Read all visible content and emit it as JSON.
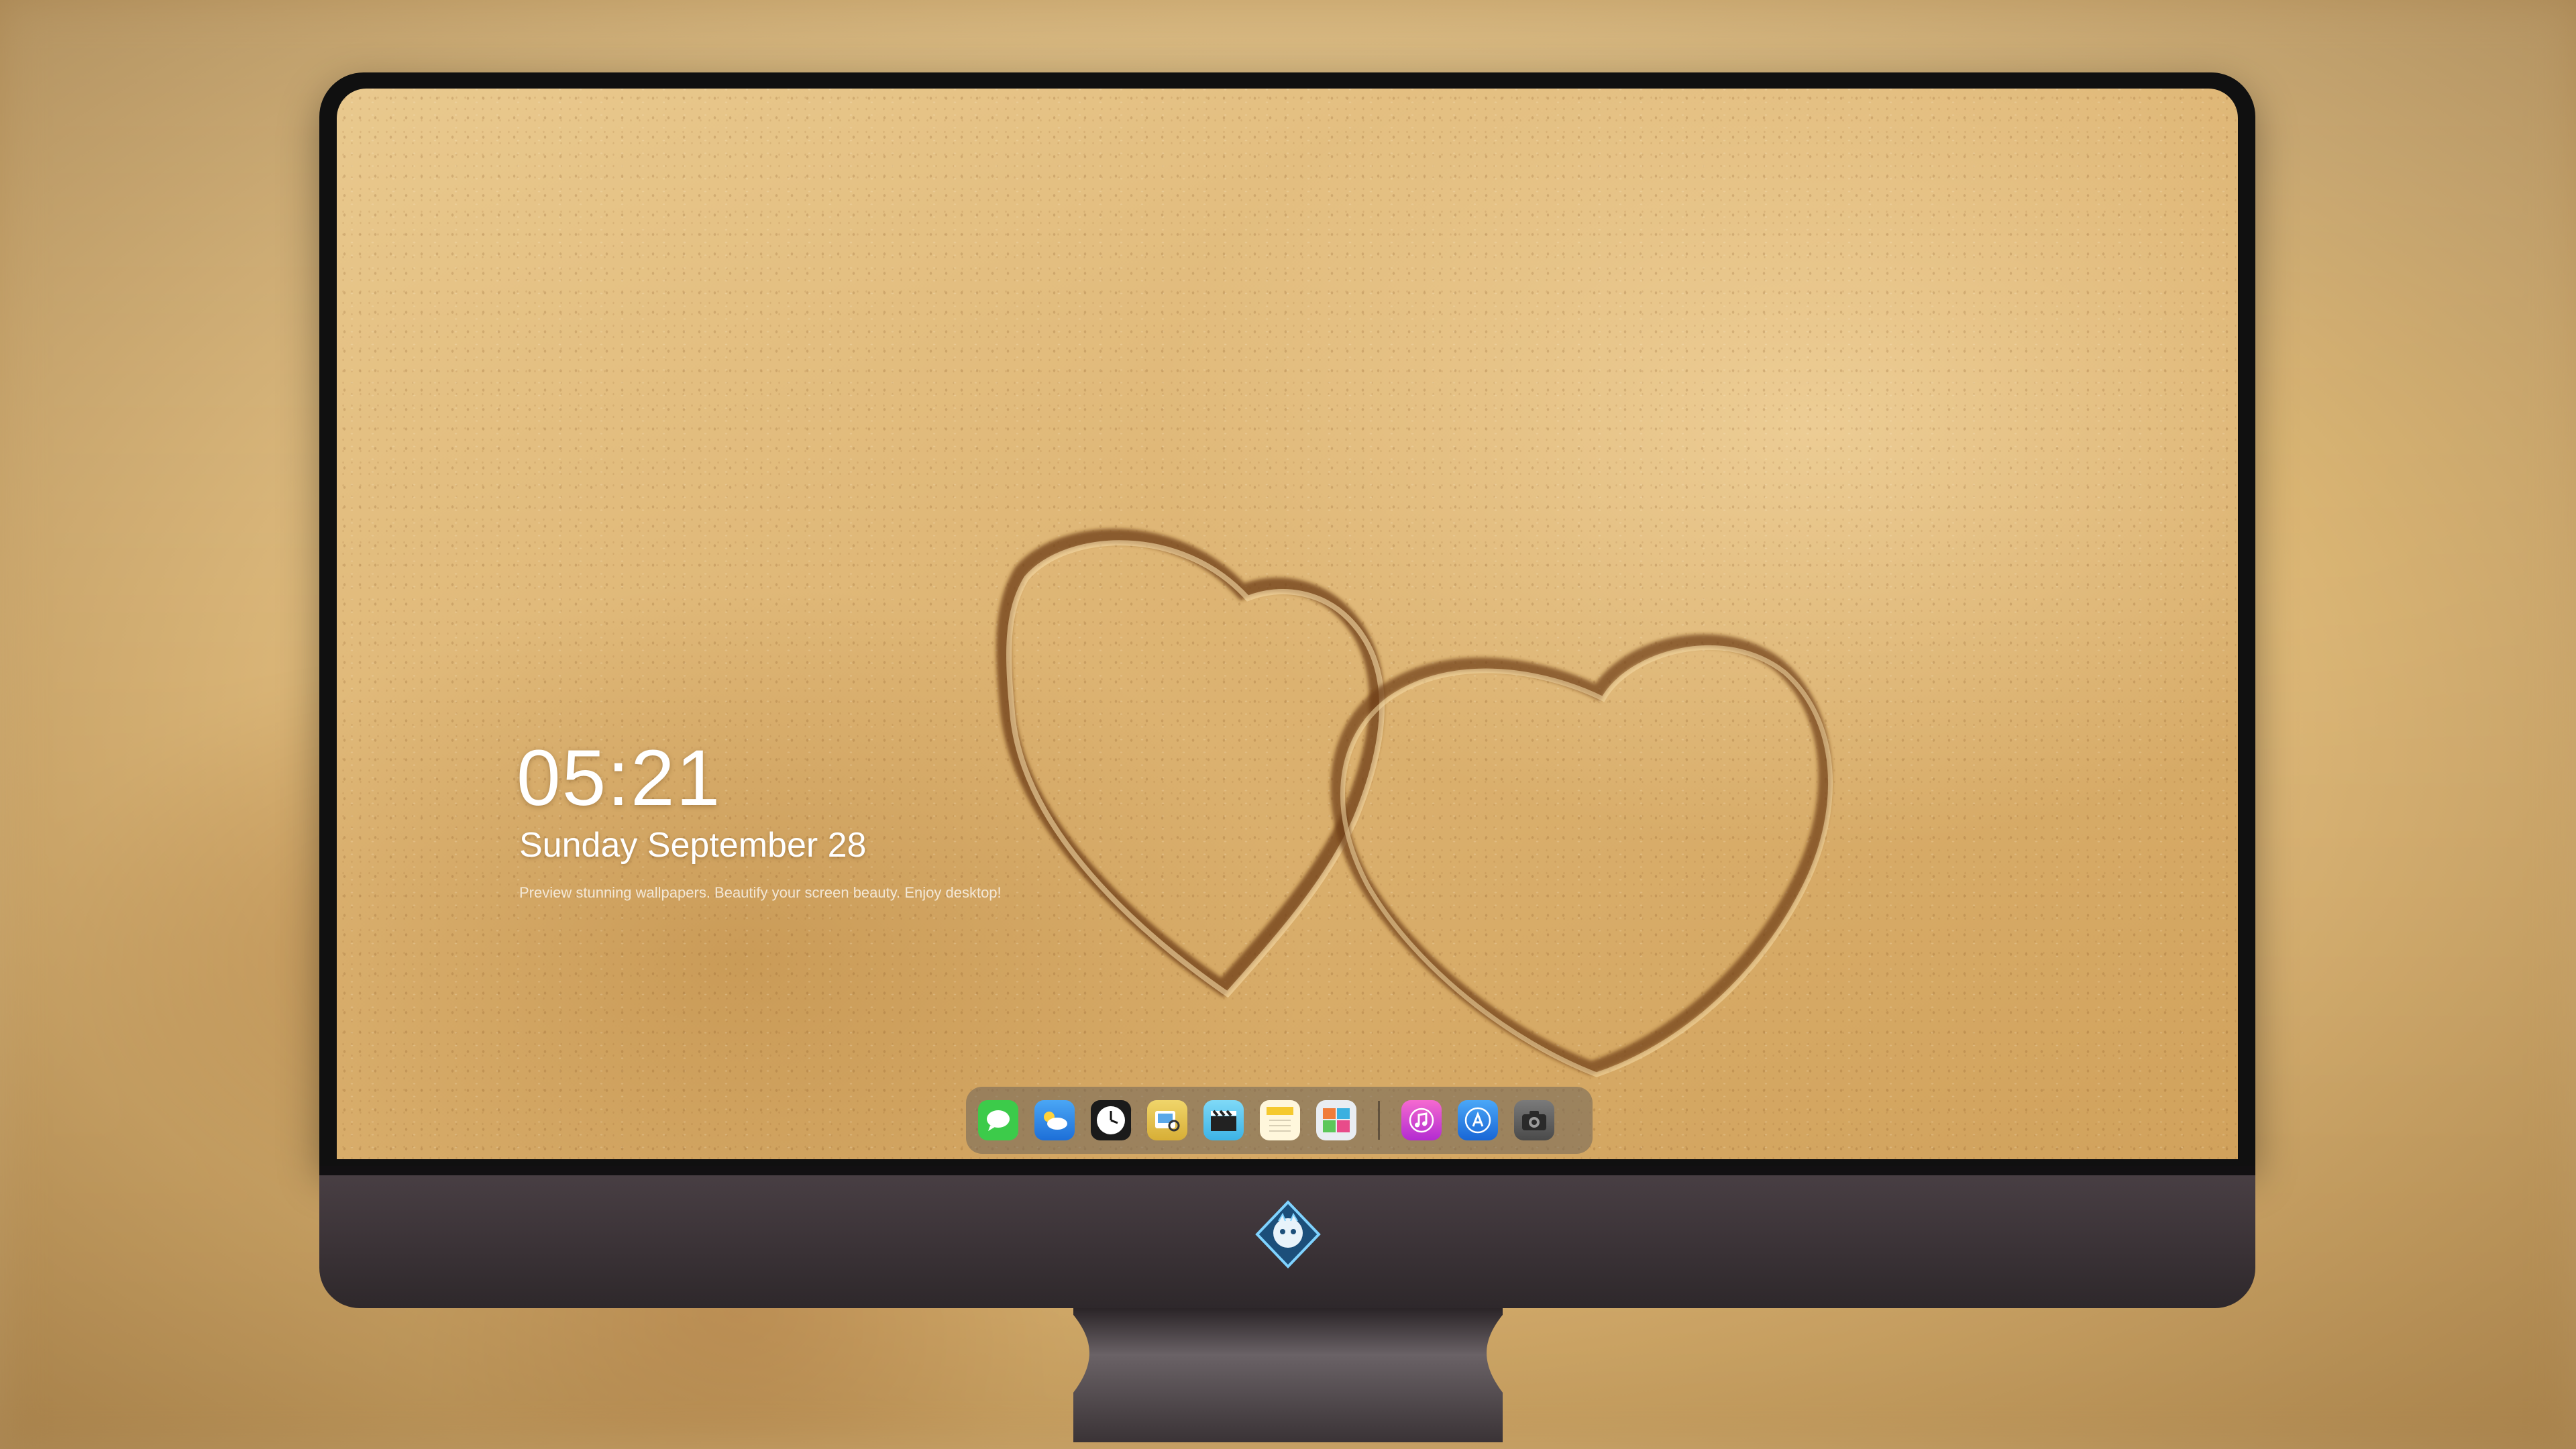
{
  "lockscreen": {
    "time": "05:21",
    "date": "Sunday September  28",
    "tagline": "Preview stunning wallpapers. Beautify your screen beauty. Enjoy desktop!"
  },
  "dock": {
    "apps": [
      {
        "name": "messages",
        "icon": "message-bubble-icon",
        "color": "#3ccb4a"
      },
      {
        "name": "weather",
        "icon": "cloud-sun-icon",
        "color": "#2a8ff0"
      },
      {
        "name": "clock",
        "icon": "clock-icon",
        "color": "#1a1a1a"
      },
      {
        "name": "preview",
        "icon": "preview-icon",
        "color": "#e8c64a"
      },
      {
        "name": "clips",
        "icon": "clapperboard-icon",
        "color": "#4cc4f0"
      },
      {
        "name": "notes",
        "icon": "notes-icon",
        "color": "#f7d24a"
      },
      {
        "name": "photos",
        "icon": "photo-collage-icon",
        "color": "#dfe6ee"
      },
      {
        "name": "music",
        "icon": "music-note-icon",
        "color": "#e040b8"
      },
      {
        "name": "app-store",
        "icon": "app-store-icon",
        "color": "#2d8cf0"
      },
      {
        "name": "camera",
        "icon": "camera-icon",
        "color": "#5a5a5a"
      }
    ]
  },
  "colors": {
    "bezel": "#101010",
    "chin": "#3a3236",
    "sand": "#deb574"
  }
}
